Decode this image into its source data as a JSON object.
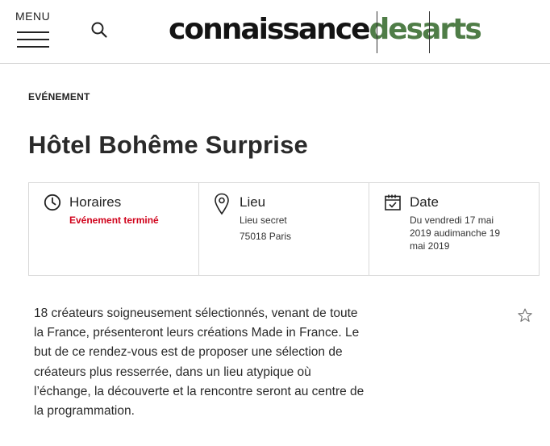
{
  "header": {
    "menu_label": "MENU",
    "logo_part1": "connaissance",
    "logo_part2": "desarts",
    "brand_green": "#4f7d47"
  },
  "article": {
    "kicker": "EVÉNEMENT",
    "title": "Hôtel Bohême Surprise"
  },
  "info": {
    "horaires": {
      "label": "Horaires",
      "status": "Evénement terminé"
    },
    "lieu": {
      "label": "Lieu",
      "line1": "Lieu secret",
      "line2": "75018 Paris"
    },
    "date": {
      "label": "Date",
      "line1": "Du vendredi 17 mai",
      "line2": "2019 audimanche 19",
      "line3": "mai 2019"
    }
  },
  "description": "18 créateurs soigneusement sélectionnés, venant de toute la France, présenteront leurs créations Made in France. Le but de ce rendez-vous est de proposer une sélection de créateurs plus resserrée, dans un lieu atypique où l’échange, la découverte et la rencontre seront au centre de la programmation.",
  "icons": [
    "search-icon",
    "clock-icon",
    "location-pin-icon",
    "calendar-icon",
    "star-icon"
  ]
}
